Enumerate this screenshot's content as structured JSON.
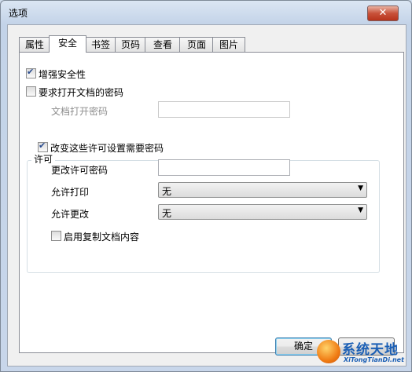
{
  "window": {
    "title": "选项",
    "close_glyph": "✕"
  },
  "tabs": [
    {
      "label": "属性"
    },
    {
      "label": "安全"
    },
    {
      "label": "书签"
    },
    {
      "label": "页码"
    },
    {
      "label": "查看"
    },
    {
      "label": "页面"
    },
    {
      "label": "图片"
    }
  ],
  "active_tab": "安全",
  "security": {
    "enhanced_security": {
      "label": "增强安全性",
      "checked": true
    },
    "require_open_password": {
      "label": "要求打开文档的密码",
      "checked": false
    },
    "open_password": {
      "label": "文档打开密码",
      "value": ""
    },
    "permissions": {
      "group_title": "许可",
      "change_permissions": {
        "label": "改变这些许可设置需要密码",
        "checked": true
      },
      "permission_password": {
        "label": "更改许可密码",
        "value": ""
      },
      "allow_print": {
        "label": "允许打印",
        "value": "无"
      },
      "allow_change": {
        "label": "允许更改",
        "value": "无"
      },
      "enable_copy": {
        "label": "启用复制文档内容",
        "checked": false
      }
    }
  },
  "buttons": {
    "ok": "确定"
  },
  "watermark": {
    "title": "系统天地",
    "subtitle": "XiTongTianDi.net"
  }
}
